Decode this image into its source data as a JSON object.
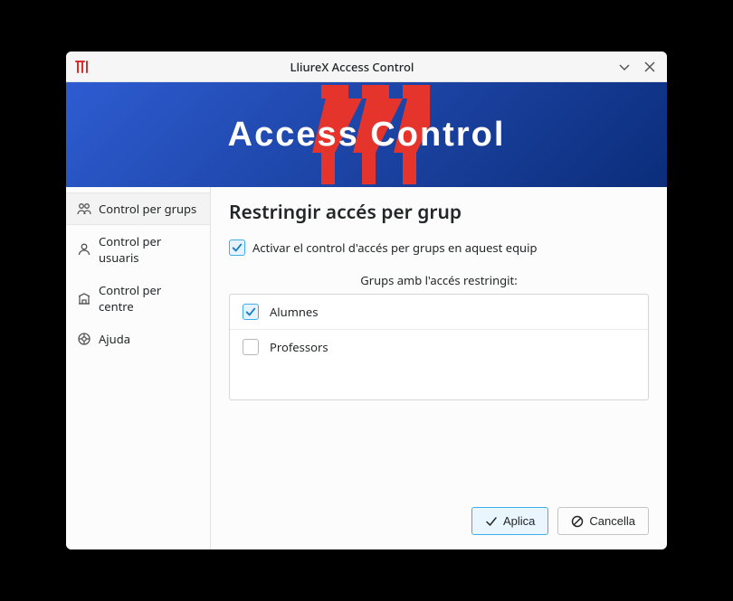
{
  "window": {
    "title": "LliureX Access Control"
  },
  "banner": {
    "text": "Access Control"
  },
  "sidebar": {
    "items": [
      {
        "label": "Control per grups",
        "selected": true
      },
      {
        "label": "Control per usuaris",
        "selected": false
      },
      {
        "label": "Control per centre",
        "selected": false
      },
      {
        "label": "Ajuda",
        "selected": false
      }
    ]
  },
  "main": {
    "heading": "Restringir accés per grup",
    "enable_checkbox": {
      "checked": true,
      "label": "Activar el control d'accés per grups en aquest equip"
    },
    "group_list_label": "Grups amb l'accés restringit:",
    "groups": [
      {
        "name": "Alumnes",
        "checked": true
      },
      {
        "name": "Professors",
        "checked": false
      }
    ]
  },
  "buttons": {
    "apply": "Aplica",
    "cancel": "Cancella"
  }
}
